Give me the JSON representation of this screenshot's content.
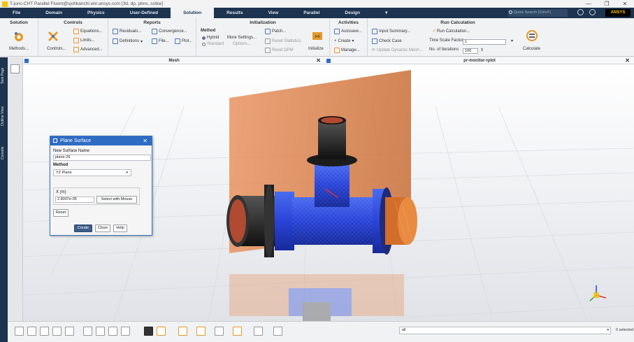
{
  "window": {
    "title": "T-junc-CHT Parallel Fluent@sjohkanchi.win.ansys.com  [3d, dp, pbns, sstkw]",
    "controls": [
      "—",
      "❐",
      "✕"
    ]
  },
  "menubar": {
    "tabs": [
      "File",
      "Domain",
      "Physics",
      "User-Defined",
      "Solution",
      "Results",
      "View",
      "Parallel",
      "Design"
    ],
    "active": "Solution",
    "quick_search_placeholder": "Quick Search (Ctrl+F)",
    "brand": "ANSYS"
  },
  "ribbon": {
    "solution": {
      "title": "Solution",
      "methods": "Methods..."
    },
    "controls": {
      "title": "Controls",
      "controls": "Controls...",
      "equations": "Equations...",
      "limits": "Limits...",
      "advanced": "Advanced..."
    },
    "reports": {
      "title": "Reports",
      "residuals": "Residuals...",
      "definitions": "Definitions",
      "convergence": "Convergence...",
      "file": "File...",
      "plot": "Plot..."
    },
    "initialization": {
      "title": "Initialization",
      "method_label": "Method",
      "hybrid": "Hybrid",
      "standard": "Standard",
      "more_settings": "More Settings...",
      "options": "Options...",
      "patch": "Patch...",
      "reset_statistics": "Reset Statistics",
      "reset_dpm": "Reset DPM",
      "initialize": "Initialize"
    },
    "activities": {
      "title": "Activities",
      "autosave": "Autosave...",
      "create": "Create",
      "manage": "Manage..."
    },
    "run_calculation": {
      "title": "Run Calculation",
      "input_summary": "Input Summary...",
      "check_case": "Check Case",
      "update_dynamic_mesh": "Update Dynamic Mesh...",
      "run_calculation_btn": "Run Calculation...",
      "time_scale_factor_label": "Time Scale Factor",
      "time_scale_factor_value": "1",
      "num_iterations_label": "No. of Iterations",
      "num_iterations_value": "100",
      "calculate": "Calculate"
    }
  },
  "left_tabs": [
    "Task Page",
    "Outline View",
    "Console"
  ],
  "panes": {
    "left_title": "Mesh",
    "right_title": "pr-monitor-rplot"
  },
  "dialog": {
    "title": "Plane Surface",
    "surface_name_label": "New Surface Name",
    "surface_name_value": "plane-26",
    "method_label": "Method",
    "method_value": "YZ Plane",
    "x_label": "X (m)",
    "x_value": "2.8007e-05",
    "select_with_mouse": "Select with Mouse",
    "reset": "Reset",
    "create": "Create",
    "close": "Close",
    "help": "Help"
  },
  "bottombar": {
    "selection_filter": "all",
    "selected_count": "0 selected"
  },
  "colors": {
    "ribbon_dark": "#1d3450",
    "accent_blue": "#2e6cc4",
    "plane_orange": "#e89060",
    "pipe_blue": "#2846d8",
    "brand_yellow": "#f7c400"
  }
}
